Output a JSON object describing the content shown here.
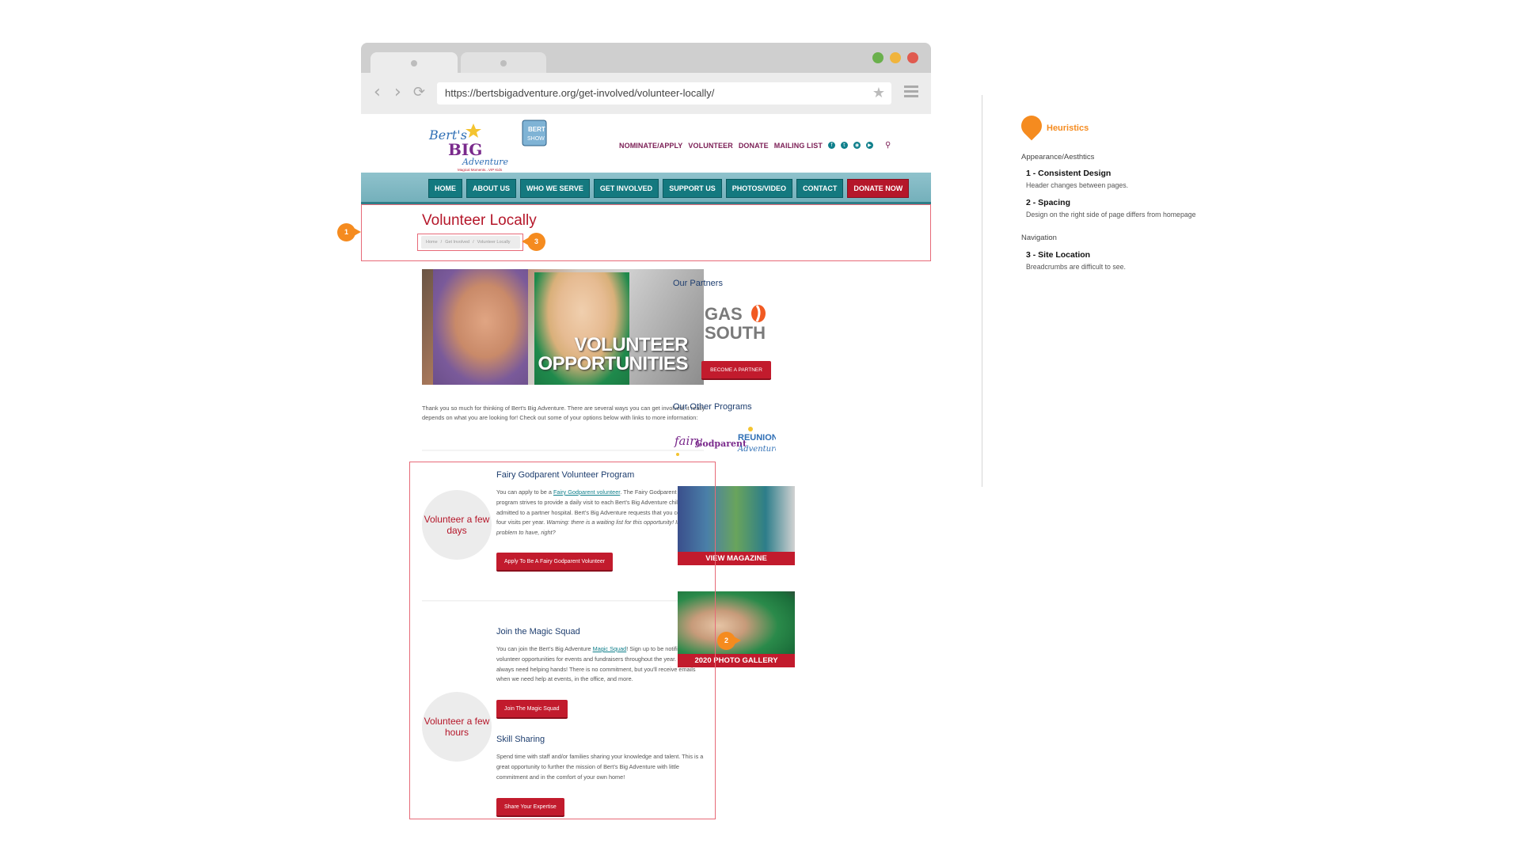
{
  "browser": {
    "url": "https://bertsbigadventure.org/get-involved/volunteer-locally/",
    "window_colors": [
      "#6ab04c",
      "#f0b43c",
      "#e05a4f"
    ]
  },
  "site": {
    "logo_text": "Bert's Big Adventure",
    "logo_tagline": "Magical Moments...VIP Kids",
    "top_nav": [
      "NOMINATE/APPLY",
      "VOLUNTEER",
      "DONATE",
      "MAILING LIST"
    ],
    "main_nav": [
      "HOME",
      "ABOUT US",
      "WHO WE SERVE",
      "GET INVOLVED",
      "SUPPORT US",
      "PHOTOS/VIDEO",
      "CONTACT",
      "DONATE NOW"
    ],
    "page_title": "Volunteer Locally",
    "breadcrumb": [
      "Home",
      "/",
      "Get Involved",
      "/",
      "Volunteer Locally"
    ],
    "hero": {
      "line1": "VOLUNTEER",
      "line2": "OPPORTUNITIES"
    },
    "intro": "Thank you so much for thinking of Bert's Big Adventure. There are several ways you can get involved; it really depends on what you are looking for! Check out some of your options below with links to more information:",
    "section1": {
      "circle": "Volunteer a few days",
      "title": "Fairy Godparent Volunteer Program",
      "body_pre": "You can apply to be a ",
      "body_link": "Fairy Godparent volunteer",
      "body_post": ". The Fairy Godparent volunteer program strives to provide a daily visit to each Bert's Big Adventure child that is admitted to a partner hospital. Bert's Big Adventure requests that you commit to four visits per year. ",
      "body_italic": "Warning: there is a waiting list for this opportunity! It's a good problem to have, right?",
      "button": "Apply To Be A Fairy Godparent Volunteer"
    },
    "section2": {
      "circle": "Volunteer a few hours",
      "title": "Join the Magic Squad",
      "body_pre": "You can join the Bert's Big Adventure ",
      "body_link": "Magic Squad",
      "body_post": "! Sign up to be notified about volunteer opportunities for events and fundraisers throughout the year. We always need helping hands! There is no commitment, but you'll receive emails when we need help at events, in the office, and more.",
      "button": "Join The Magic Squad"
    },
    "section3": {
      "title": "Skill Sharing",
      "body": "Spend time with staff and/or families sharing your knowledge and talent. This is a great opportunity to further the mission of Bert's Big Adventure with little commitment and in the comfort of your own home!",
      "button": "Share Your Expertise"
    },
    "sidebar": {
      "partners_title": "Our Partners",
      "partner_logo_line1": "GAS",
      "partner_logo_line2": "SOUTH",
      "partner_button": "BECOME A PARTNER",
      "programs_title": "Our Other Programs",
      "magazine_caption": "VIEW MAGAZINE",
      "gallery_caption": "2020 PHOTO GALLERY"
    }
  },
  "annotations": {
    "markers": [
      "1",
      "2",
      "3"
    ]
  },
  "heuristics": {
    "title": "Heuristics",
    "category1": "Appearance/Aesthtics",
    "item1_title": "1 - Consistent Design",
    "item1_desc": "Header changes between pages.",
    "item2_title": "2 - Spacing",
    "item2_desc": "Design on the right side of page differs from homepage",
    "category2": "Navigation",
    "item3_title": "3 - Site Location",
    "item3_desc": "Breadcrumbs are difficult to see."
  },
  "colors": {
    "accent": "#f58b1f",
    "brand_red": "#b5172a",
    "teal": "#14797f",
    "highlight": "#e76a78"
  }
}
